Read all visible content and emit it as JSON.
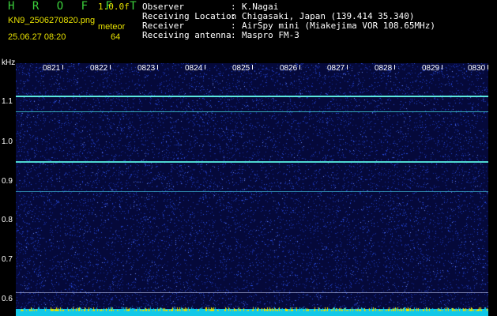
{
  "header": {
    "title": "H R O F F T",
    "version": "1.0.0f",
    "filename": "KN9_2506270820.png",
    "meteor_label": "meteor",
    "datetime": "25.06.27 08:20",
    "meteor_count": "64",
    "info": [
      {
        "key": "Observer",
        "value": "K.Nagai"
      },
      {
        "key": "Receiving Location",
        "value": "Chigasaki, Japan (139.414 35.340)"
      },
      {
        "key": "Receiver",
        "value": "AirSpy mini (Miakejima VOR 108.65MHz)"
      },
      {
        "key": "Receiving antenna",
        "value": "Maspro FM-3"
      }
    ]
  },
  "axis": {
    "y_unit": "kHz",
    "y_labels": [
      "1.1",
      "1.0",
      "0.9",
      "0.8",
      "0.7",
      "0.6"
    ],
    "x_labels": [
      "0821",
      "0822",
      "0823",
      "0824",
      "0825",
      "0826",
      "0827",
      "0828",
      "0829",
      "0830"
    ]
  },
  "colors": {
    "background": "#000000",
    "plot_bg": "#05093a",
    "noise": "#2a4fe0",
    "trace": "#4fe4d8",
    "title_green": "#3bd03b",
    "label_yellow": "#e6e000"
  }
}
